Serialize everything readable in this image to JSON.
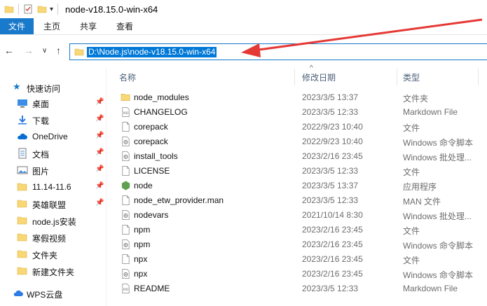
{
  "window": {
    "title": "node-v18.15.0-win-x64"
  },
  "ribbon": {
    "tabs": [
      "文件",
      "主页",
      "共享",
      "查看"
    ]
  },
  "address": {
    "path": "D:\\Node.js\\node-v18.15.0-win-x64"
  },
  "columns": {
    "name": "名称",
    "date": "修改日期",
    "type": "类型"
  },
  "sidebar": {
    "quick_access": "快速访问",
    "items": [
      {
        "label": "桌面",
        "icon": "desktop-icon",
        "pinned": true
      },
      {
        "label": "下载",
        "icon": "download-icon",
        "pinned": true
      },
      {
        "label": "OneDrive",
        "icon": "onedrive-icon",
        "pinned": true
      },
      {
        "label": "文档",
        "icon": "documents-icon",
        "pinned": true
      },
      {
        "label": "图片",
        "icon": "pictures-icon",
        "pinned": true
      },
      {
        "label": "11.14-11.6",
        "icon": "folder-icon",
        "pinned": true
      },
      {
        "label": "英雄联盟",
        "icon": "folder-icon",
        "pinned": true
      },
      {
        "label": "node.js安装",
        "icon": "folder-icon",
        "pinned": false
      },
      {
        "label": "寒假视频",
        "icon": "folder-icon",
        "pinned": false
      },
      {
        "label": "文件夹",
        "icon": "folder-icon",
        "pinned": false
      },
      {
        "label": "新建文件夹",
        "icon": "folder-icon",
        "pinned": false
      }
    ],
    "wps": "WPS云盘"
  },
  "files": [
    {
      "name": "node_modules",
      "date": "2023/3/5 13:37",
      "type": "文件夹",
      "icon": "folder-icon"
    },
    {
      "name": "CHANGELOG",
      "date": "2023/3/5 12:33",
      "type": "Markdown File",
      "icon": "markdown-file-icon"
    },
    {
      "name": "corepack",
      "date": "2022/9/23 10:40",
      "type": "文件",
      "icon": "file-icon"
    },
    {
      "name": "corepack",
      "date": "2022/9/23 10:40",
      "type": "Windows 命令脚本",
      "icon": "script-icon"
    },
    {
      "name": "install_tools",
      "date": "2023/2/16 23:45",
      "type": "Windows 批处理...",
      "icon": "script-icon"
    },
    {
      "name": "LICENSE",
      "date": "2023/3/5 12:33",
      "type": "文件",
      "icon": "file-icon"
    },
    {
      "name": "node",
      "date": "2023/3/5 13:37",
      "type": "应用程序",
      "icon": "node-app-icon"
    },
    {
      "name": "node_etw_provider.man",
      "date": "2023/3/5 12:33",
      "type": "MAN 文件",
      "icon": "file-icon"
    },
    {
      "name": "nodevars",
      "date": "2021/10/14 8:30",
      "type": "Windows 批处理...",
      "icon": "script-icon"
    },
    {
      "name": "npm",
      "date": "2023/2/16 23:45",
      "type": "文件",
      "icon": "file-icon"
    },
    {
      "name": "npm",
      "date": "2023/2/16 23:45",
      "type": "Windows 命令脚本",
      "icon": "script-icon"
    },
    {
      "name": "npx",
      "date": "2023/2/16 23:45",
      "type": "文件",
      "icon": "file-icon"
    },
    {
      "name": "npx",
      "date": "2023/2/16 23:45",
      "type": "Windows 命令脚本",
      "icon": "script-icon"
    },
    {
      "name": "README",
      "date": "2023/3/5 12:33",
      "type": "Markdown File",
      "icon": "markdown-file-icon"
    }
  ],
  "colors": {
    "accent": "#1979ca",
    "selection": "#0078d7",
    "folder": "#f8d775",
    "arrow": "#e53935"
  }
}
